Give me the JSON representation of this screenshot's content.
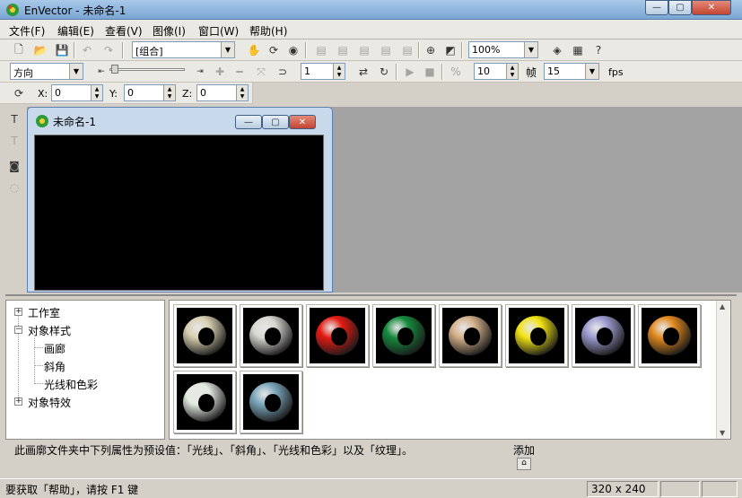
{
  "window": {
    "title": "EnVector - 未命名-1",
    "controls": {
      "minimize": "—",
      "maximize": "▢",
      "close": "✕"
    }
  },
  "menu": [
    "文件(F)",
    "编辑(E)",
    "查看(V)",
    "图像(I)",
    "窗口(W)",
    "帮助(H)"
  ],
  "toolbar1": {
    "group_combo": "[组合]",
    "zoom_combo": "100%"
  },
  "toolbar2": {
    "direction_combo": "方向",
    "frame_spin": "1",
    "speed_spin": "10",
    "frame_label": "帧",
    "fps_combo": "15",
    "fps_label": "fps"
  },
  "toolbar3": {
    "x_label": "X:",
    "x_value": "0",
    "y_label": "Y:",
    "y_value": "0",
    "z_label": "Z:",
    "z_value": "0"
  },
  "child_window": {
    "title": "未命名-1"
  },
  "tree": [
    {
      "label": "工作室",
      "expander": "+"
    },
    {
      "label": "对象样式",
      "expander": "−"
    },
    {
      "label": "画廊"
    },
    {
      "label": "斜角"
    },
    {
      "label": "光线和色彩"
    },
    {
      "label": "对象特效",
      "expander": "+"
    }
  ],
  "gallery": {
    "items": [
      {
        "name": "beige-torus",
        "color": "#d8cfb0"
      },
      {
        "name": "white-torus",
        "color": "#d9d6d0"
      },
      {
        "name": "red-torus",
        "color": "#e61a12"
      },
      {
        "name": "green-torus",
        "color": "#158a3c"
      },
      {
        "name": "tan-torus",
        "color": "#d4b08a"
      },
      {
        "name": "yellow-torus",
        "color": "#f2e412"
      },
      {
        "name": "lavender-torus",
        "color": "#9a9bd0"
      },
      {
        "name": "orange-torus",
        "color": "#e2891e"
      },
      {
        "name": "pearl-torus",
        "color": "#e4ece2"
      },
      {
        "name": "bluegray-torus",
        "color": "#7ba7bb"
      }
    ]
  },
  "description": "此画廓文件夹中下列属性为预设值：「光线」、「斜角」、「光线和色彩」以及「纹理」。",
  "add_label": "添加",
  "statusbar": {
    "help_text": "要获取「帮助」，请按 F1 键",
    "dimensions": "320 x 240"
  }
}
